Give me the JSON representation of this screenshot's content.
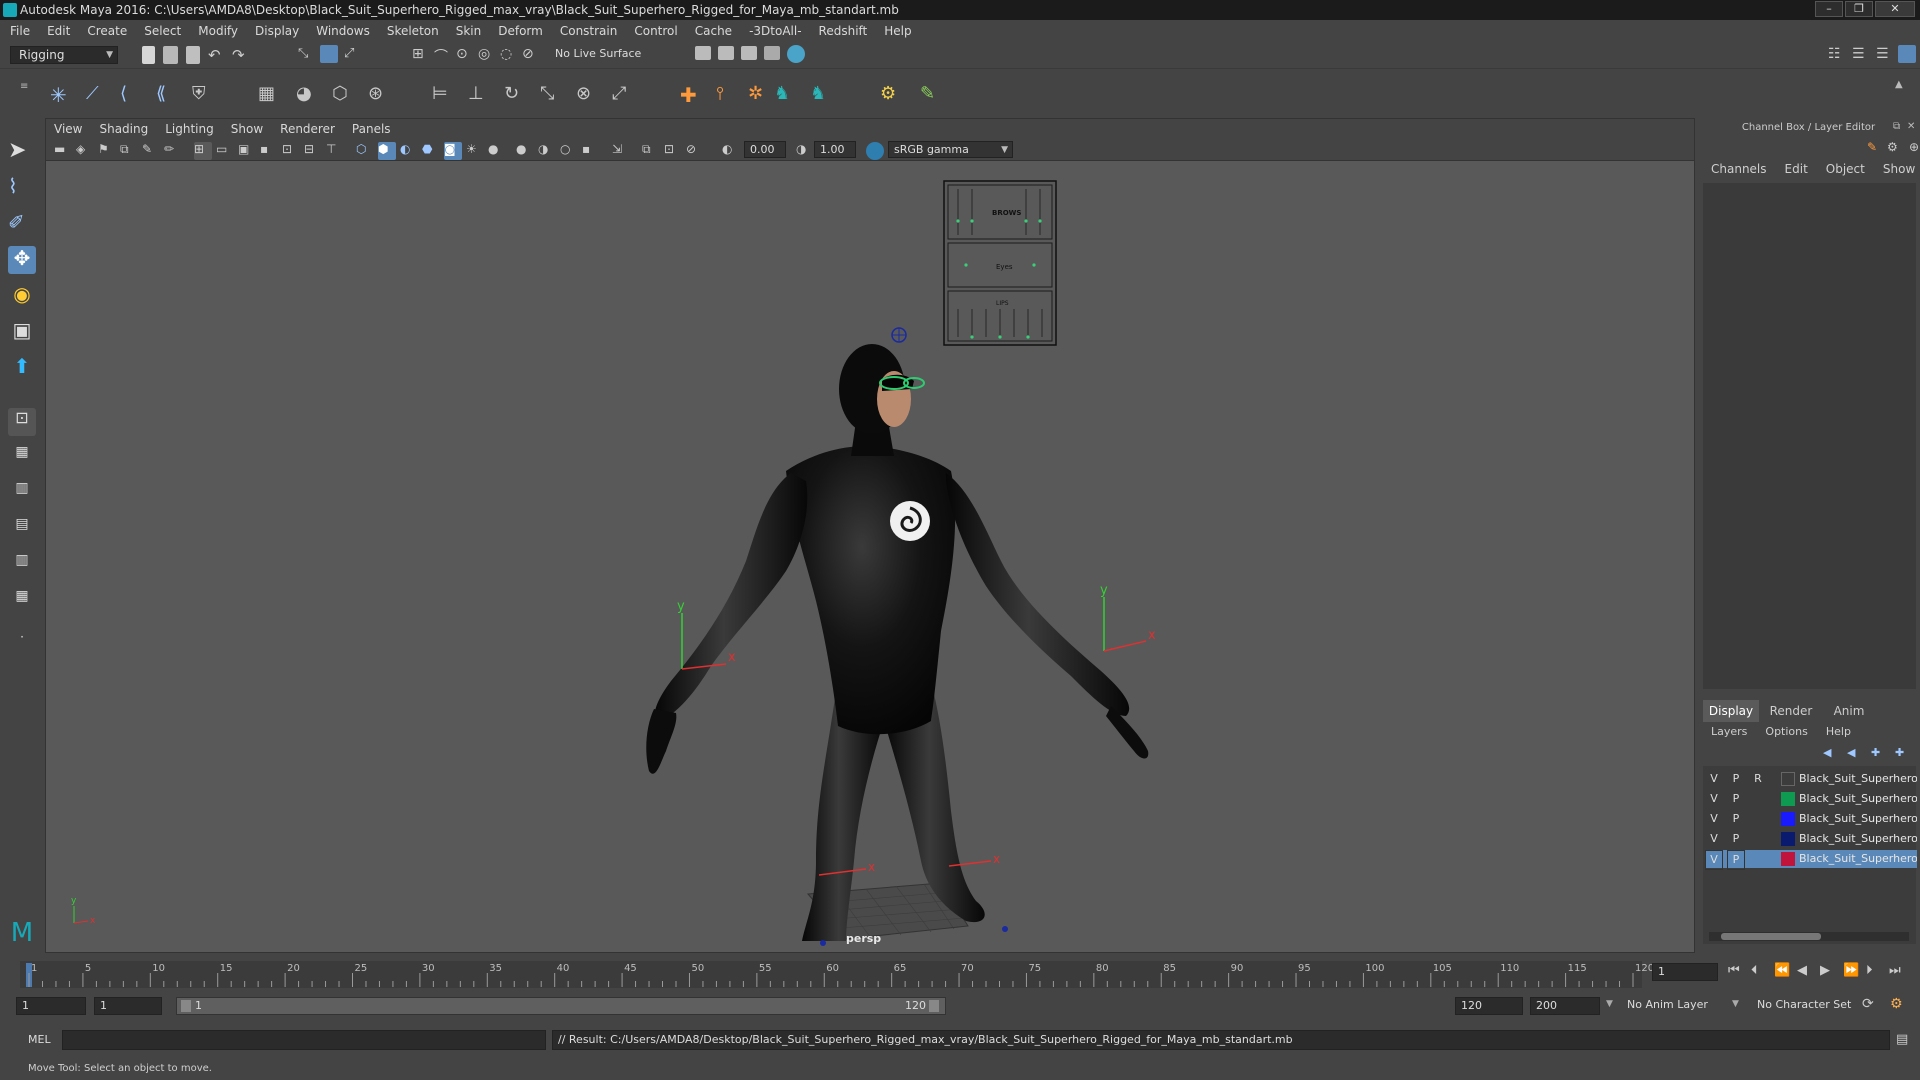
{
  "window": {
    "title": "Autodesk Maya 2016: C:\\Users\\AMDA8\\Desktop\\Black_Suit_Superhero_Rigged_max_vray\\Black_Suit_Superhero_Rigged_for_Maya_mb_standart.mb"
  },
  "menubar": [
    "File",
    "Edit",
    "Create",
    "Select",
    "Modify",
    "Display",
    "Windows",
    "Skeleton",
    "Skin",
    "Deform",
    "Constrain",
    "Control",
    "Cache",
    "-3DtoAll-",
    "Redshift",
    "Help"
  ],
  "statusline": {
    "mode": "Rigging",
    "live_surface": "No Live Surface"
  },
  "panel": {
    "menus": [
      "View",
      "Shading",
      "Lighting",
      "Show",
      "Renderer",
      "Panels"
    ],
    "exposure": "0.00",
    "gamma": "1.00",
    "color_space": "sRGB gamma",
    "camera": "persp"
  },
  "facial_controls": {
    "brows": "BROWS",
    "eyes": "Eyes",
    "lips": "LIPS"
  },
  "axis_labels": {
    "x": "x",
    "y": "y"
  },
  "channelbox": {
    "title": "Channel Box / Layer Editor",
    "menus": [
      "Channels",
      "Edit",
      "Object",
      "Show"
    ],
    "tabs": [
      "Display",
      "Render",
      "Anim"
    ],
    "layer_menus": [
      "Layers",
      "Options",
      "Help"
    ],
    "layers": [
      {
        "v": "V",
        "p": "P",
        "r": "R",
        "name": "Black_Suit_Superhero_",
        "color": "#444444",
        "selected": false
      },
      {
        "v": "V",
        "p": "P",
        "r": "",
        "name": "Black_Suit_Superhero_",
        "color": "#0f9a52",
        "selected": false
      },
      {
        "v": "V",
        "p": "P",
        "r": "",
        "name": "Black_Suit_Superhero_",
        "color": "#1a1aff",
        "selected": false
      },
      {
        "v": "V",
        "p": "P",
        "r": "",
        "name": "Black_Suit_Superhero_",
        "color": "#0a1a6e",
        "selected": false
      },
      {
        "v": "V",
        "p": "P",
        "r": "",
        "name": "Black_Suit_Superhero_",
        "color": "#c0143c",
        "selected": true
      }
    ]
  },
  "timeline": {
    "ticks": [
      "1",
      "5",
      "10",
      "15",
      "20",
      "25",
      "30",
      "35",
      "40",
      "45",
      "50",
      "55",
      "60",
      "65",
      "70",
      "75",
      "80",
      "85",
      "90",
      "95",
      "100",
      "105",
      "110",
      "115",
      "120"
    ],
    "current_frame": "1"
  },
  "range": {
    "start": "1",
    "playback_start": "1",
    "slider_start": "1",
    "slider_end": "120",
    "playback_end": "120",
    "end": "200",
    "anim_layer": "No Anim Layer",
    "character_set": "No Character Set"
  },
  "cmdline": {
    "lang": "MEL",
    "result": "// Result: C:/Users/AMDA8/Desktop/Black_Suit_Superhero_Rigged_max_vray/Black_Suit_Superhero_Rigged_for_Maya_mb_standart.mb"
  },
  "helpline": "Move Tool: Select an object to move."
}
